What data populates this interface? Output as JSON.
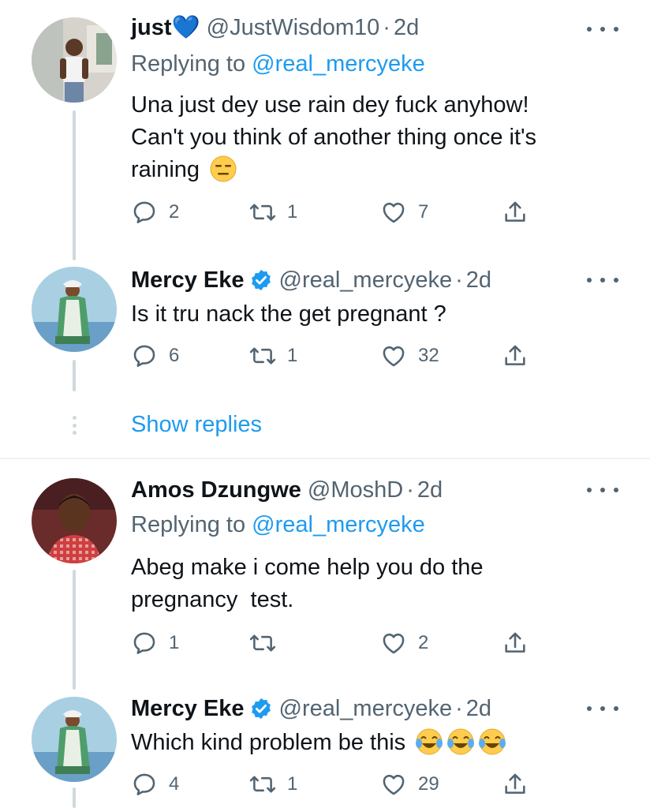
{
  "tweets": [
    {
      "name": "just💙",
      "handle": "@JustWisdom10",
      "dot": "·",
      "time": "2d",
      "replying_prefix": "Replying to ",
      "replying_to": "@real_mercyeke",
      "text_lines": [
        "Una just dey use rain dey fuck anyhow!",
        "Can't you think of another thing once it's",
        "raining"
      ],
      "emojis": [
        "😑"
      ],
      "replies": "2",
      "retweets": "1",
      "likes": "7"
    },
    {
      "name": "Mercy Eke",
      "verified": true,
      "handle": "@real_mercyeke",
      "dot": "·",
      "time": "2d",
      "text_lines": [
        "Is it tru nack the get pregnant ?"
      ],
      "replies": "6",
      "retweets": "1",
      "likes": "32"
    },
    {
      "name": "Amos Dzungwe",
      "handle": "@MoshD",
      "dot": "·",
      "time": "2d",
      "replying_prefix": "Replying to ",
      "replying_to": "@real_mercyeke",
      "text_lines": [
        "Abeg make i come help you do the",
        "pregnancy  test."
      ],
      "replies": "1",
      "retweets": "",
      "likes": "2"
    },
    {
      "name": "Mercy Eke",
      "verified": true,
      "handle": "@real_mercyeke",
      "dot": "·",
      "time": "2d",
      "text_lines": [
        "Which kind problem be this"
      ],
      "emojis": [
        "😂",
        "😂",
        "😂"
      ],
      "replies": "4",
      "retweets": "1",
      "likes": "29"
    }
  ],
  "show_replies": "Show replies",
  "colors": {
    "link": "#1d9bf0",
    "secondary": "#536471",
    "thread_line": "#cfd9de",
    "verified": "#1d9bf0"
  },
  "icons": [
    "reply-icon",
    "retweet-icon",
    "like-icon",
    "share-icon",
    "more-icon",
    "verified-badge-icon"
  ]
}
